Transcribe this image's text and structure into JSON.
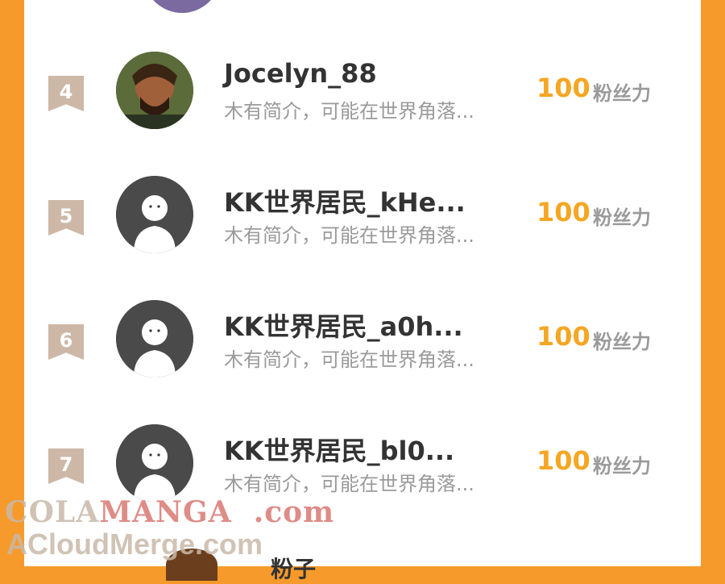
{
  "colors": {
    "background": "#f79a2c",
    "panel": "#ffffff",
    "rank_badge": "#cdb8a7",
    "score": "#f5a623",
    "text_muted": "#9a9a9a",
    "text_main": "#333333"
  },
  "list": [
    {
      "rank": "4",
      "name": "Jocelyn_88",
      "bio": "木有简介，可能在世界角落...",
      "score": "100",
      "unit": "粉丝力",
      "avatar": "photo"
    },
    {
      "rank": "5",
      "name": "KK世界居民_kHe...",
      "bio": "木有简介，可能在世界角落...",
      "score": "100",
      "unit": "粉丝力",
      "avatar": "default"
    },
    {
      "rank": "6",
      "name": "KK世界居民_a0h...",
      "bio": "木有简介，可能在世界角落...",
      "score": "100",
      "unit": "粉丝力",
      "avatar": "default"
    },
    {
      "rank": "7",
      "name": "KK世界居民_bl0...",
      "bio": "木有简介，可能在世界角落...",
      "score": "100",
      "unit": "粉丝力",
      "avatar": "default"
    }
  ],
  "partial_next_name": "粉子",
  "watermark": {
    "line1_a": "COLA",
    "line1_b": "MANGA",
    "line1_c": ".com",
    "line2": "ACloudMerge.com"
  }
}
